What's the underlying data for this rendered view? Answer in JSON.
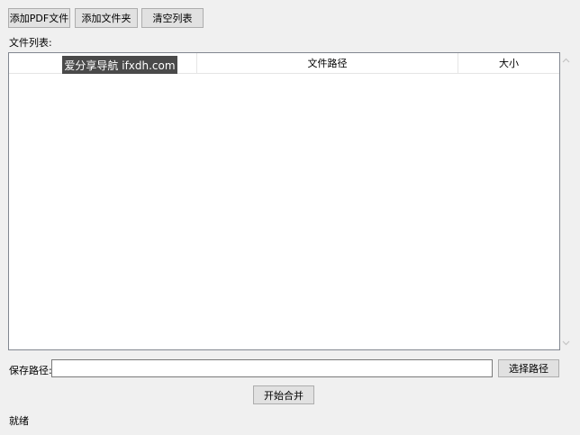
{
  "toolbar": {
    "add_pdf_label": "添加PDF文件",
    "add_folder_label": "添加文件夹",
    "clear_list_label": "清空列表"
  },
  "file_list": {
    "label": "文件列表:",
    "columns": [
      "",
      "文件路径",
      "大小"
    ],
    "rows": []
  },
  "watermark": {
    "text": "爱分享导航 ifxdh.com"
  },
  "save": {
    "label": "保存路径:",
    "value": "",
    "choose_label": "选择路径"
  },
  "merge": {
    "label": "开始合并"
  },
  "status": {
    "text": "就绪"
  },
  "icons": {
    "scroll_up": "scroll-up-arrow-icon",
    "scroll_down": "scroll-down-arrow-icon"
  }
}
